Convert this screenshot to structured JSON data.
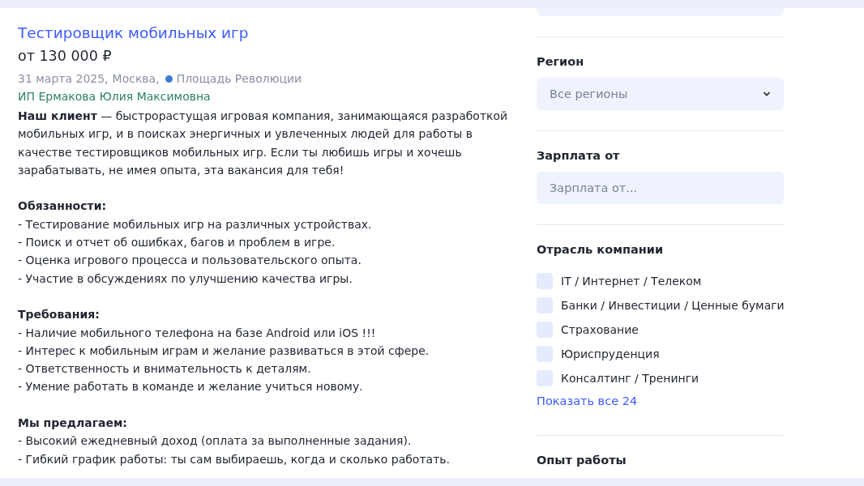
{
  "vacancy": {
    "title": "Тестировщик мобильных игр",
    "salary": "от 130 000 ₽",
    "date": "31 марта 2025,",
    "city": "Москва,",
    "metro": {
      "name": "Площадь Революции",
      "color": "#3a7bd5"
    },
    "company": "ИП Ермакова Юлия Максимовна",
    "description": [
      {
        "kind": "paragraph",
        "text": "**Наш клиент** — быстрорастущая игровая компания, занимающаяся разработкой мобильных игр, и в поисках энергичных и увлеченных людей для работы в качестве тестировщиков мобильных игр. Если ты любишь игры и хочешь зарабатывать, не имея опыта, эта вакансия для тебя!"
      },
      {
        "kind": "section",
        "heading": "Обязанности:",
        "items": [
          "- Тестирование мобильных игр на различных устройствах.",
          "- Поиск и отчет об ошибках, багов и проблем в игре.",
          "- Оценка игрового процесса и пользовательского опыта.",
          "- Участие в обсуждениях по улучшению качества игры."
        ]
      },
      {
        "kind": "section",
        "heading": "Требования:",
        "items": [
          "- Наличие мобильного телефона на базе Android или iOS !!!",
          "- Интерес к мобильным играм и желание развиваться в этой сфере.",
          "- Ответственность и внимательность к деталям.",
          "- Умение работать в команде и желание учиться новому."
        ]
      },
      {
        "kind": "section",
        "heading": "Мы предлагаем:",
        "items": [
          "- Высокий ежедневный доход (оплата за выполненные задания).",
          "- Гибкий график работы: ты сам выбираешь, когда и сколько работать."
        ]
      }
    ]
  },
  "filters": [
    {
      "kind": "select",
      "label": "Регион",
      "value": "Все регионы"
    },
    {
      "kind": "input",
      "label": "Зарплата от",
      "placeholder": "Зарплата от..."
    },
    {
      "kind": "checklist",
      "label": "Отрасль компании",
      "options": [
        {
          "label": "IT / Интернет / Телеком",
          "checked": false
        },
        {
          "label": "Банки / Инвестиции / Ценные бумаги",
          "checked": false
        },
        {
          "label": "Страхование",
          "checked": false
        },
        {
          "label": "Юриспруденция",
          "checked": false
        },
        {
          "label": "Консалтинг / Тренинги",
          "checked": false
        }
      ],
      "more": "Показать все 24"
    },
    {
      "kind": "heading",
      "label": "Опыт работы"
    }
  ]
}
